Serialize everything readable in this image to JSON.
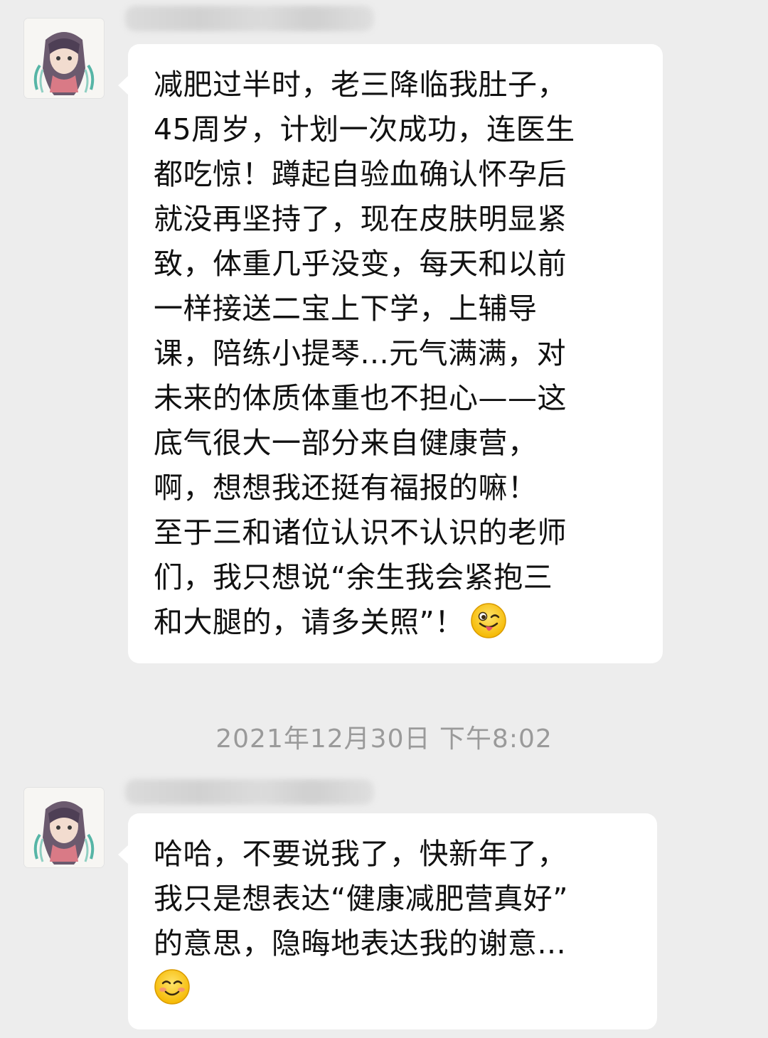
{
  "messages": [
    {
      "text": "减肥过半时，老三降临我肚子，\n45周岁，计划一次成功，连医生\n都吃惊！蹲起自验血确认怀孕后\n就没再坚持了，现在皮肤明显紧\n致，体重几乎没变，每天和以前\n一样接送二宝上下学，上辅导\n课，陪练小提琴...元气满满，对\n未来的体质体重也不担心——这\n底气很大一部分来自健康营，\n啊，想想我还挺有福报的嘛！\n至于三和诸位认识不认识的老师\n们，我只想说“余生我会紧抱三\n和大腿的，请多关照”！",
      "emoji": "wink-tongue-emoji"
    },
    {
      "text": "哈哈，不要说我了，快新年了，\n我只是想表达“健康减肥营真好”\n的意思，隐晦地表达我的谢意...\n",
      "emoji": "smile-blush-emoji"
    }
  ],
  "timestamp": "2021年12月30日 下午8:02",
  "colors": {
    "background": "#ededed",
    "bubble": "#ffffff",
    "text": "#111111",
    "timestamp": "#9a9a9a"
  }
}
